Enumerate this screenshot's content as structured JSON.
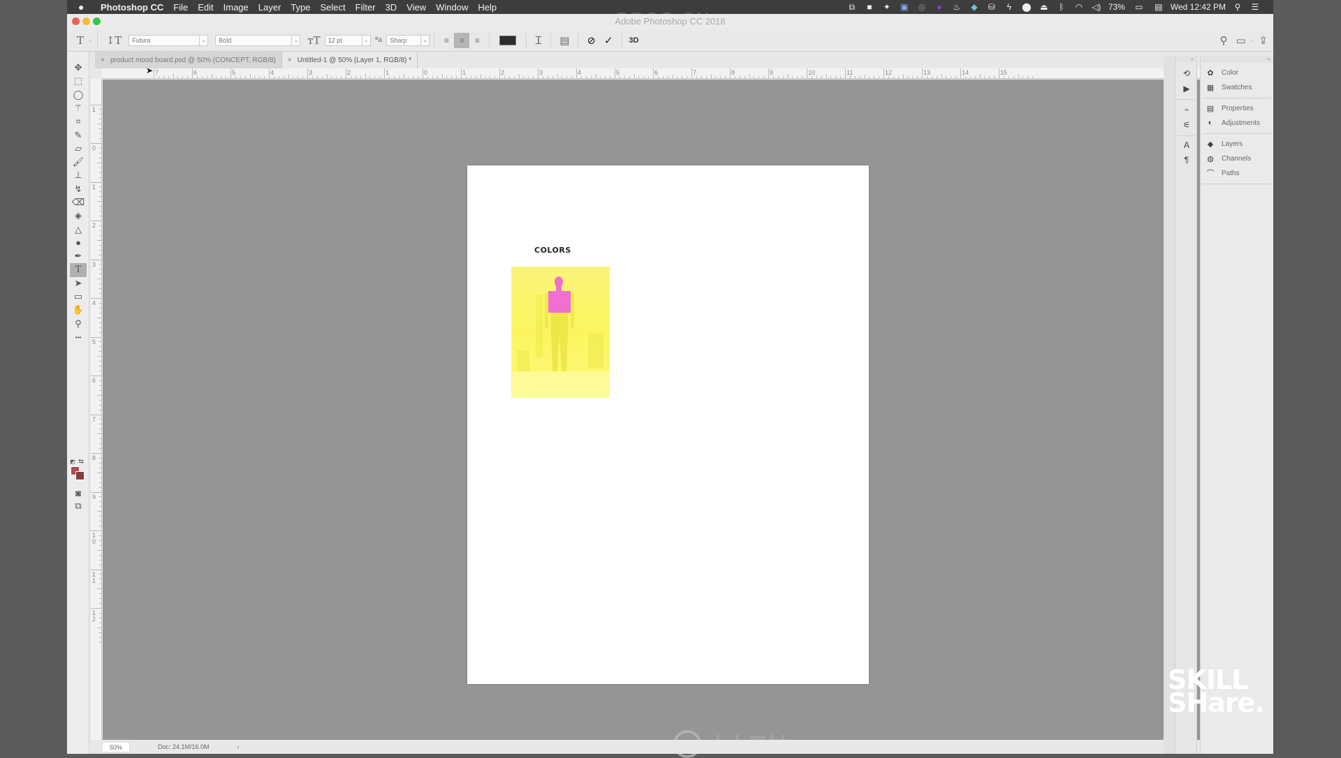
{
  "menubar": {
    "app_name": "Photoshop CC",
    "menus": [
      "File",
      "Edit",
      "Image",
      "Layer",
      "Type",
      "Select",
      "Filter",
      "3D",
      "View",
      "Window",
      "Help"
    ],
    "status_icons": [
      "screen-record-icon",
      "zoom-icon",
      "dropbox-icon",
      "finder-icon",
      "creative-cloud-icon",
      "app-icon",
      "flame-icon",
      "vpn-icon",
      "backup-icon",
      "bolt-icon",
      "display-icon",
      "airplay-icon",
      "bluetooth-icon",
      "wifi-icon",
      "volume-icon"
    ],
    "battery": "73%",
    "clock": "Wed 12:42 PM"
  },
  "window": {
    "title": "Adobe Photoshop CC 2018",
    "watermark_top": "RRCG.CN"
  },
  "options_bar": {
    "font_family": "Futura",
    "font_style": "Bold",
    "font_size": "12 pt",
    "antialias": "Sharp",
    "alignment_active": "center",
    "text_color": "#2c2c2c",
    "commit_3d_label": "3D"
  },
  "tabs": [
    {
      "label": "product mood board.psd @ 50% (CONCEPT, RGB/8)",
      "active": false
    },
    {
      "label": "Untitled-1 @ 50% (Layer 1, RGB/8) *",
      "active": true
    }
  ],
  "tools": [
    {
      "name": "move-tool",
      "glyph": "✥"
    },
    {
      "name": "marquee-tool",
      "glyph": "⬚"
    },
    {
      "name": "lasso-tool",
      "glyph": "◯"
    },
    {
      "name": "magic-wand-tool",
      "glyph": "⚚"
    },
    {
      "name": "crop-tool",
      "glyph": "⌗"
    },
    {
      "name": "eyedropper-tool",
      "glyph": "✎"
    },
    {
      "name": "healing-brush-tool",
      "glyph": "▱"
    },
    {
      "name": "brush-tool",
      "glyph": "🖌"
    },
    {
      "name": "clone-stamp-tool",
      "glyph": "⊥"
    },
    {
      "name": "history-brush-tool",
      "glyph": "↯"
    },
    {
      "name": "eraser-tool",
      "glyph": "⌫"
    },
    {
      "name": "paint-bucket-tool",
      "glyph": "◈"
    },
    {
      "name": "blur-tool",
      "glyph": "△"
    },
    {
      "name": "dodge-tool",
      "glyph": "●"
    },
    {
      "name": "pen-tool",
      "glyph": "✒"
    },
    {
      "name": "type-tool",
      "glyph": "T",
      "active": true
    },
    {
      "name": "path-selection-tool",
      "glyph": "➤"
    },
    {
      "name": "rectangle-tool",
      "glyph": "▭"
    },
    {
      "name": "hand-tool",
      "glyph": "✋"
    },
    {
      "name": "zoom-tool",
      "glyph": "⚲"
    },
    {
      "name": "more-tools",
      "glyph": "•••"
    }
  ],
  "colors": {
    "foreground": "#b54950",
    "background": "#8a3b3f"
  },
  "rulers": {
    "horizontal": [
      "7",
      "6",
      "5",
      "4",
      "3",
      "2",
      "1",
      "0",
      "1",
      "2",
      "3",
      "4",
      "5",
      "6",
      "7",
      "8",
      "9",
      "10",
      "11",
      "12",
      "13",
      "14",
      "15"
    ],
    "vertical": [
      "1",
      "0",
      "1",
      "2",
      "3",
      "4",
      "5",
      "6",
      "7",
      "8",
      "9",
      "10",
      "11",
      "12"
    ]
  },
  "document": {
    "heading": "COLORS",
    "image_colors": {
      "background": "#fbf65f",
      "shirt": "#f06fd0"
    }
  },
  "status_bar": {
    "zoom": "50%",
    "doc_info": "Doc: 24.1M/16.0M",
    "arrow": "›"
  },
  "panels": {
    "icon_column": [
      "history-icon",
      "actions-play-icon",
      "brush-settings-icon",
      "tool-presets-icon",
      "character-icon",
      "paragraph-icon"
    ],
    "groups": [
      [
        {
          "label": "Color",
          "icon": "palette-icon"
        },
        {
          "label": "Swatches",
          "icon": "grid-icon"
        }
      ],
      [
        {
          "label": "Properties",
          "icon": "properties-icon"
        },
        {
          "label": "Adjustments",
          "icon": "adjustments-icon"
        }
      ],
      [
        {
          "label": "Layers",
          "icon": "layers-icon"
        },
        {
          "label": "Channels",
          "icon": "channels-icon"
        },
        {
          "label": "Paths",
          "icon": "paths-icon"
        }
      ]
    ]
  },
  "watermarks": {
    "skillshare_line1": "SKILL",
    "skillshare_line2": "SHare.",
    "rr_logo": "ML",
    "rr_text": "人人素材"
  }
}
